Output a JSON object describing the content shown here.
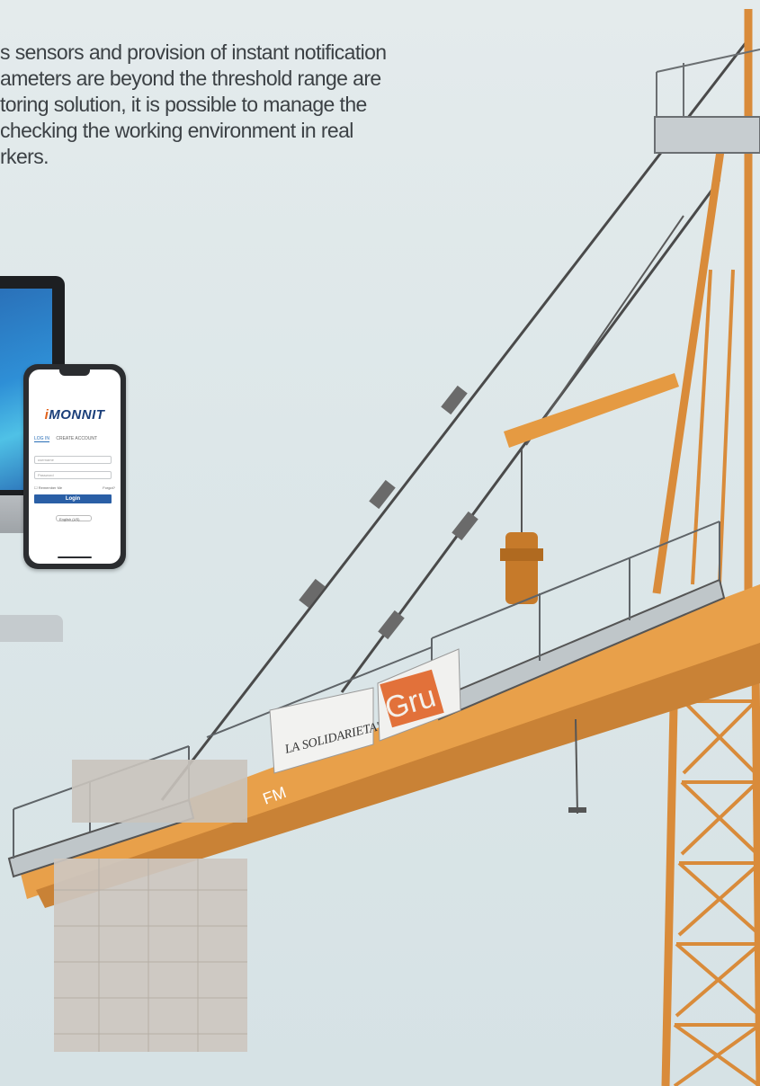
{
  "intro_lines": [
    "s sensors and provision of instant notification",
    "ameters are beyond the threshold range are",
    "toring solution, it is possible to manage the",
    " checking the working environment in real",
    "rkers."
  ],
  "phone": {
    "brand": "MONNIT",
    "tab_login": "LOG IN",
    "tab_create": "CREATE ACCOUNT",
    "username_placeholder": "username",
    "password_placeholder": "Password",
    "remember_label": "Remember Me",
    "forgot_label": "Forgot?",
    "login_button": "Login",
    "language": "English (US)"
  },
  "banners": {
    "banner_1": "LA SOLIDARIETA'",
    "banner_2": "Gru",
    "jib_label": "FM"
  },
  "colors": {
    "crane_orange": "#e8a04a",
    "sky": "#dfe8ea",
    "text": "#3c4145",
    "brand_blue": "#1b3f7a",
    "login_blue": "#2a5fa6"
  }
}
